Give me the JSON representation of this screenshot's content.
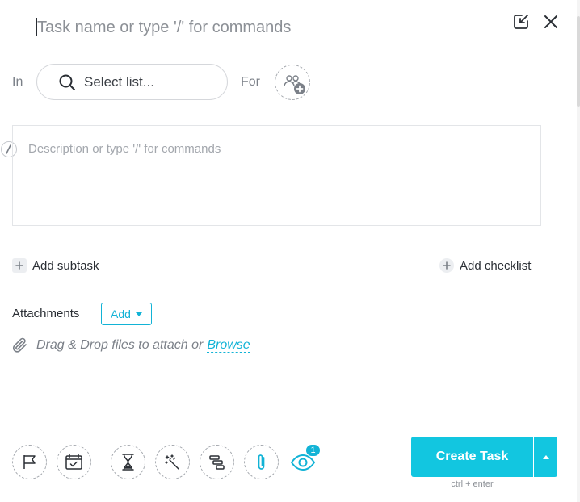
{
  "task_name": {
    "placeholder": "Task name or type '/' for commands",
    "value": ""
  },
  "header": {
    "expand_icon": "expand-icon",
    "close_icon": "close-icon"
  },
  "location": {
    "in_label": "In",
    "list_select_text": "Select list...",
    "for_label": "For",
    "assignee_icon": "add-assignee-icon"
  },
  "description": {
    "placeholder": "Description or type '/' for commands",
    "value": ""
  },
  "actions": {
    "add_subtask": "Add subtask",
    "add_checklist": "Add checklist"
  },
  "attachments": {
    "title": "Attachments",
    "add_label": "Add",
    "drop_text": "Drag & Drop files to attach or",
    "browse_label": "Browse"
  },
  "toolbar": {
    "tools": [
      "priority-flag-icon",
      "due-date-icon",
      "time-estimate-icon",
      "tags-icon",
      "dependencies-icon",
      "attachment-icon"
    ],
    "watchers_count": "1"
  },
  "create": {
    "label": "Create Task",
    "shortcut_hint": "ctrl + enter"
  },
  "colors": {
    "accent": "#12c6e0",
    "link": "#12b3d6",
    "text": "#2a2e34",
    "muted": "#7b8088"
  }
}
